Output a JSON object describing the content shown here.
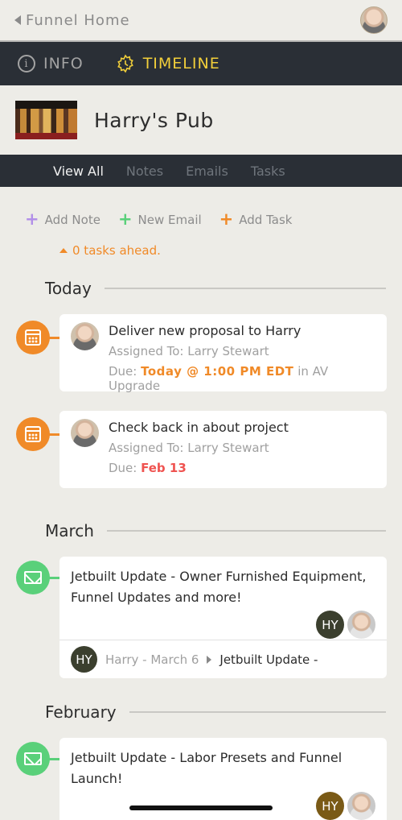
{
  "topbar": {
    "back_label": "Funnel Home"
  },
  "tabs": {
    "info": "INFO",
    "timeline": "TIMELINE"
  },
  "header": {
    "title": "Harry's Pub"
  },
  "subtabs": [
    "View All",
    "Notes",
    "Emails",
    "Tasks"
  ],
  "actions": {
    "add_note": "Add Note",
    "new_email": "New Email",
    "add_task": "Add Task"
  },
  "tasks_ahead": "0 tasks ahead.",
  "sections": {
    "today": "Today",
    "march": "March",
    "february": "February"
  },
  "tasks": [
    {
      "title": "Deliver new proposal to Harry",
      "assigned": "Assigned To: Larry Stewart",
      "due_prefix": "Due:",
      "due_value": "Today @ 1:00 PM EDT",
      "due_suffix": "in AV Upgrade"
    },
    {
      "title": "Check back in about project",
      "assigned": "Assigned To: Larry Stewart",
      "due_prefix": "Due:",
      "due_value": "Feb 13"
    }
  ],
  "emails": [
    {
      "title": "Jetbuilt Update - Owner Furnished Equipment, Funnel Updates and more!",
      "initials": "HY",
      "foot_initials": "HY",
      "foot_meta": "Harry - March 6",
      "foot_subject": "Jetbuilt Update -"
    },
    {
      "title": "Jetbuilt Update - Labor Presets and Funnel Launch!",
      "initials": "HY"
    }
  ],
  "colors": {
    "accent_orange": "#f08a28",
    "accent_green": "#5ad07a",
    "timeline_yellow": "#f2cf3a",
    "dark_bar": "#2a2f36",
    "due_red": "#ef5350"
  }
}
